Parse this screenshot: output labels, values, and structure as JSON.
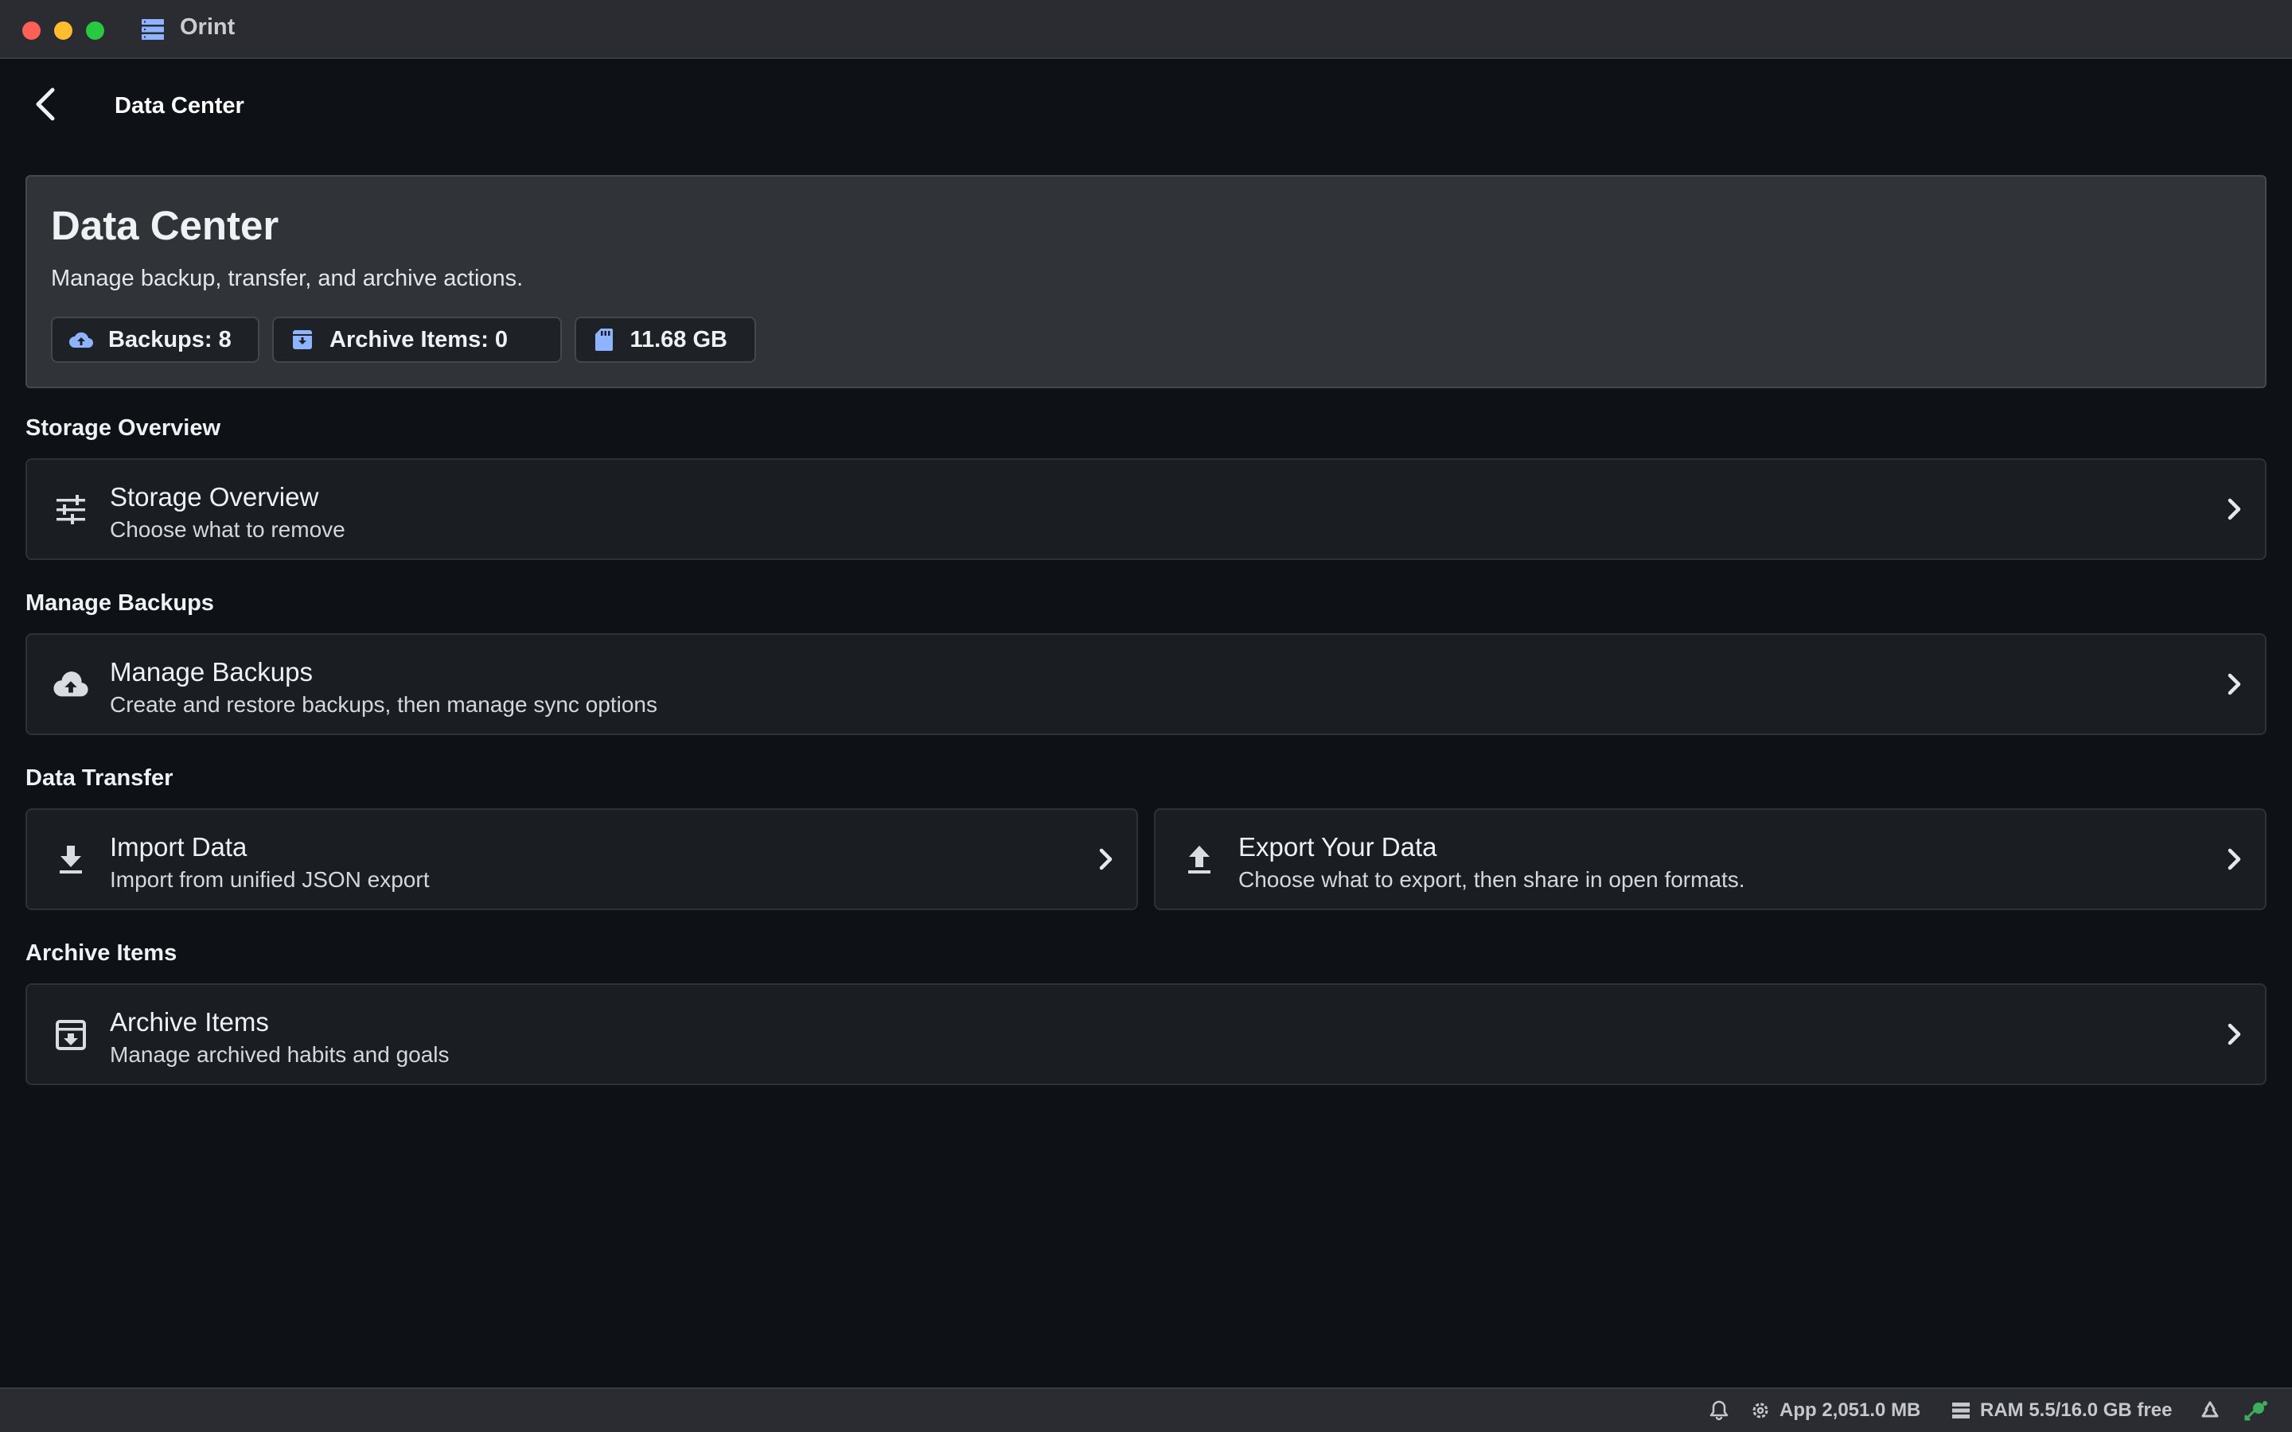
{
  "window": {
    "title": "Orint",
    "app_icon": "server-stack-icon"
  },
  "header": {
    "back_icon": "chevron-left-icon",
    "title": "Data Center"
  },
  "hero": {
    "title": "Data Center",
    "subtitle": "Manage backup, transfer, and archive actions.",
    "chips": [
      {
        "icon": "cloud-upload-icon",
        "label": "Backups: 8"
      },
      {
        "icon": "archive-box-icon",
        "label": "Archive Items: 0"
      },
      {
        "icon": "sd-card-icon",
        "label": "11.68 GB"
      }
    ]
  },
  "sections": {
    "storage": {
      "label": "Storage Overview",
      "row": {
        "icon": "tune-sliders-icon",
        "title": "Storage Overview",
        "subtitle": "Choose what to remove"
      }
    },
    "backups": {
      "label": "Manage Backups",
      "row": {
        "icon": "cloud-upload-icon",
        "title": "Manage Backups",
        "subtitle": "Create and restore backups, then manage sync options"
      }
    },
    "transfer": {
      "label": "Data Transfer",
      "import": {
        "icon": "download-icon",
        "title": "Import Data",
        "subtitle": "Import from unified JSON export"
      },
      "export": {
        "icon": "upload-icon",
        "title": "Export Your Data",
        "subtitle": "Choose what to export, then share in open formats."
      }
    },
    "archive": {
      "label": "Archive Items",
      "row": {
        "icon": "archive-box-icon",
        "title": "Archive Items",
        "subtitle": "Manage archived habits and goals"
      }
    }
  },
  "statusbar": {
    "app_memory": "App 2,051.0 MB",
    "ram": "RAM 5.5/16.0 GB free"
  },
  "colors": {
    "background": "#0e1116",
    "card": "#1a1d22",
    "hero": "#303338",
    "accent_icon": "#8fb4ff",
    "status_ok": "#3fae5a"
  }
}
